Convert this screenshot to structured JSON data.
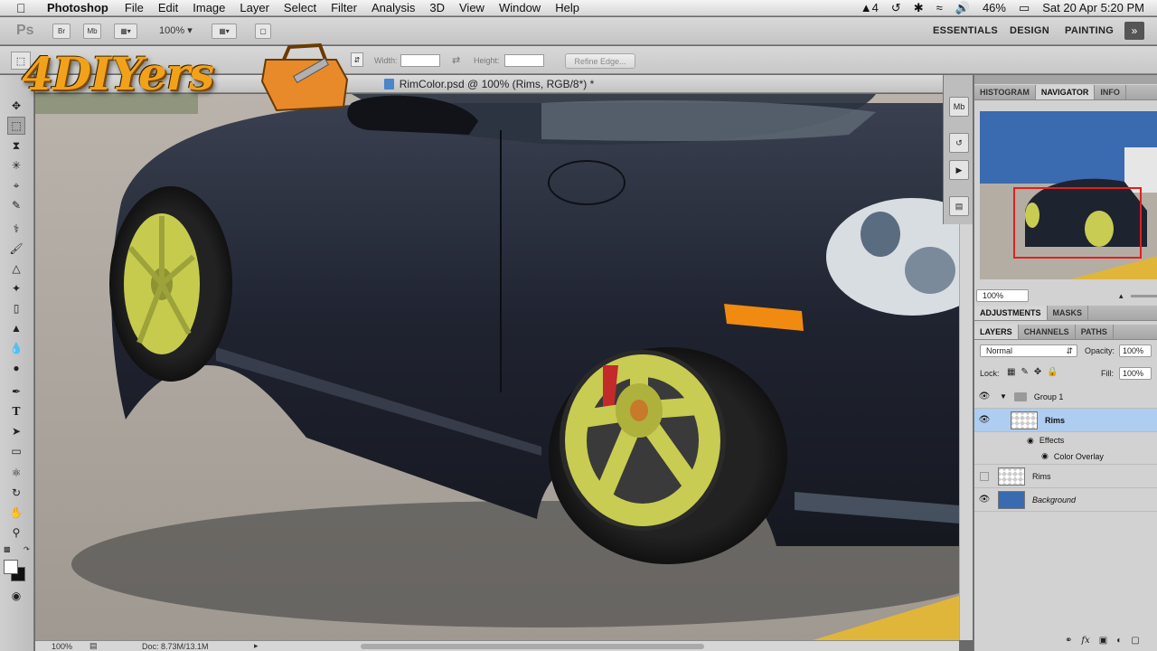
{
  "menubar": {
    "app": "Photoshop",
    "items": [
      "File",
      "Edit",
      "Image",
      "Layer",
      "Select",
      "Filter",
      "Analysis",
      "3D",
      "View",
      "Window",
      "Help"
    ],
    "status": {
      "badge": "4",
      "battery": "46%",
      "datetime": "Sat 20 Apr  5:20 PM"
    }
  },
  "appbar": {
    "logo": "Ps",
    "btn_bridge": "Br",
    "btn_minibridge": "Mb",
    "zoom": "100%",
    "workspaces": [
      "ESSENTIALS",
      "DESIGN",
      "PAINTING"
    ],
    "more": "»"
  },
  "options": {
    "width_label": "Width:",
    "height_label": "Height:",
    "refine_edge": "Refine Edge..."
  },
  "watermark": "4DIYers",
  "document": {
    "title": "RimColor.psd @ 100% (Rims, RGB/8*) *",
    "status_zoom": "100%",
    "status_doc": "Doc: 8.73M/13.1M"
  },
  "navigator_panel": {
    "tabs": [
      "HISTOGRAM",
      "NAVIGATOR",
      "INFO"
    ],
    "active_tab": "NAVIGATOR",
    "zoom": "100%"
  },
  "adjustments_panel": {
    "tabs": [
      "ADJUSTMENTS",
      "MASKS"
    ]
  },
  "layers_panel": {
    "tabs": [
      "LAYERS",
      "CHANNELS",
      "PATHS"
    ],
    "blend_mode": "Normal",
    "opacity_label": "Opacity:",
    "opacity": "100%",
    "lock_label": "Lock:",
    "fill_label": "Fill:",
    "fill": "100%",
    "layers": [
      {
        "name": "Group 1",
        "visible": true
      },
      {
        "name": "Rims",
        "visible": true,
        "selected": true
      },
      {
        "name": "Effects",
        "visible": true
      },
      {
        "name": "Color Overlay",
        "visible": true
      },
      {
        "name": "Rims",
        "visible": false
      },
      {
        "name": "Background",
        "visible": true
      }
    ]
  },
  "colors": {
    "selection": "#aecdf0",
    "car_body": "#1e2330",
    "rim": "#c8cc52",
    "asphalt": "#a7a19a"
  }
}
